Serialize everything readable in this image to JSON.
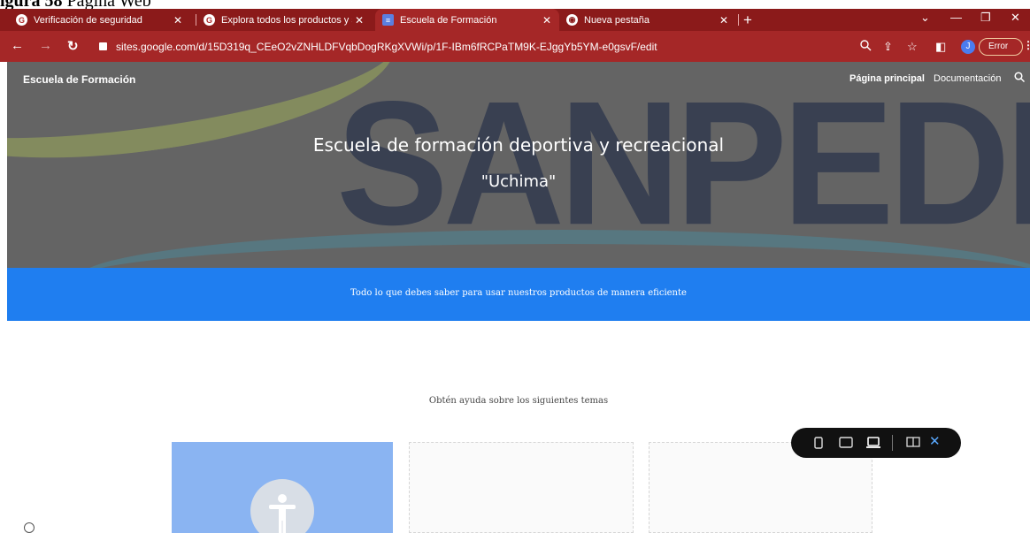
{
  "caption": {
    "label": "igura 58",
    "text": " Página Web"
  },
  "browser": {
    "tabs": [
      {
        "title": "Verificación de seguridad"
      },
      {
        "title": "Explora todos los productos y se"
      },
      {
        "title": "Escuela de Formación",
        "active": true
      },
      {
        "title": "Nueva pestaña"
      }
    ],
    "url": "sites.google.com/d/15D319q_CEeO2vZNHLDFVqbDogRKgXVWi/p/1F-IBm6fRCPaTM9K-EJggYb5YM-e0gsvF/edit",
    "profile_initial": "J",
    "error_label": "Error"
  },
  "site": {
    "brand": "Escuela de Formación",
    "nav": {
      "home": "Página principal",
      "docs": "Documentación"
    },
    "hero_bg_text": "SANPEDRO",
    "hero_title": "Escuela de formación deportiva y recreacional",
    "hero_subtitle": "\"Uchima\"",
    "band_text": "Todo lo que debes saber para usar nuestros productos de manera eficiente",
    "help_heading": "Obtén ayuda sobre los siguientes temas"
  },
  "colors": {
    "chrome": "#a52727",
    "tabstrip": "#8b1a1a",
    "band": "#1f7ef0",
    "card_blue": "#8ab4f2"
  },
  "icons": [
    "back-arrow-icon",
    "forward-arrow-icon",
    "reload-icon",
    "lock-icon",
    "zoom-icon",
    "share-icon",
    "star-icon",
    "sidepanel-icon",
    "search-icon",
    "accessibility-icon",
    "phone-preview-icon",
    "tablet-preview-icon",
    "laptop-preview-icon",
    "feedback-icon",
    "close-icon",
    "info-icon"
  ]
}
